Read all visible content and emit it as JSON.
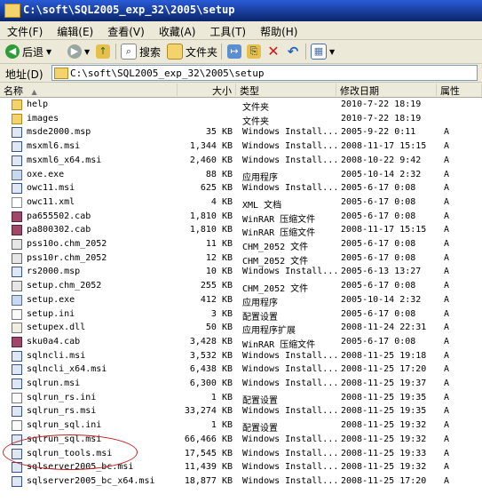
{
  "window": {
    "title": "C:\\soft\\SQL2005_exp_32\\2005\\setup"
  },
  "menu": {
    "items": [
      "文件(F)",
      "编辑(E)",
      "查看(V)",
      "收藏(A)",
      "工具(T)",
      "帮助(H)"
    ]
  },
  "toolbar": {
    "back_label": "后退",
    "search_label": "搜索",
    "folders_label": "文件夹"
  },
  "address": {
    "label": "地址(D)",
    "path": "C:\\soft\\SQL2005_exp_32\\2005\\setup"
  },
  "columns": {
    "name": "名称",
    "size": "大小",
    "type": "类型",
    "modified": "修改日期",
    "attr": "属性"
  },
  "files": [
    {
      "name": "help",
      "size": "",
      "type": "文件夹",
      "date": "2010-7-22 18:19",
      "attr": "",
      "icon": "folder"
    },
    {
      "name": "images",
      "size": "",
      "type": "文件夹",
      "date": "2010-7-22 18:19",
      "attr": "",
      "icon": "folder"
    },
    {
      "name": "msde2000.msp",
      "size": "35 KB",
      "type": "Windows Install...",
      "date": "2005-9-22 0:11",
      "attr": "A",
      "icon": "msi"
    },
    {
      "name": "msxml6.msi",
      "size": "1,344 KB",
      "type": "Windows Install...",
      "date": "2008-11-17 15:15",
      "attr": "A",
      "icon": "msi"
    },
    {
      "name": "msxml6_x64.msi",
      "size": "2,460 KB",
      "type": "Windows Install...",
      "date": "2008-10-22 9:42",
      "attr": "A",
      "icon": "msi"
    },
    {
      "name": "oxe.exe",
      "size": "88 KB",
      "type": "应用程序",
      "date": "2005-10-14 2:32",
      "attr": "A",
      "icon": "exe"
    },
    {
      "name": "owc11.msi",
      "size": "625 KB",
      "type": "Windows Install...",
      "date": "2005-6-17 0:08",
      "attr": "A",
      "icon": "msi"
    },
    {
      "name": "owc11.xml",
      "size": "4 KB",
      "type": "XML 文档",
      "date": "2005-6-17 0:08",
      "attr": "A",
      "icon": "xml"
    },
    {
      "name": "pa655502.cab",
      "size": "1,810 KB",
      "type": "WinRAR 压缩文件",
      "date": "2005-6-17 0:08",
      "attr": "A",
      "icon": "cab"
    },
    {
      "name": "pa800302.cab",
      "size": "1,810 KB",
      "type": "WinRAR 压缩文件",
      "date": "2008-11-17 15:15",
      "attr": "A",
      "icon": "cab"
    },
    {
      "name": "pss10o.chm_2052",
      "size": "11 KB",
      "type": "CHM_2052 文件",
      "date": "2005-6-17 0:08",
      "attr": "A",
      "icon": "chm"
    },
    {
      "name": "pss10r.chm_2052",
      "size": "12 KB",
      "type": "CHM_2052 文件",
      "date": "2005-6-17 0:08",
      "attr": "A",
      "icon": "chm"
    },
    {
      "name": "rs2000.msp",
      "size": "10 KB",
      "type": "Windows Install...",
      "date": "2005-6-13 13:27",
      "attr": "A",
      "icon": "msi"
    },
    {
      "name": "setup.chm_2052",
      "size": "255 KB",
      "type": "CHM_2052 文件",
      "date": "2005-6-17 0:08",
      "attr": "A",
      "icon": "chm"
    },
    {
      "name": "setup.exe",
      "size": "412 KB",
      "type": "应用程序",
      "date": "2005-10-14 2:32",
      "attr": "A",
      "icon": "exe"
    },
    {
      "name": "setup.ini",
      "size": "3 KB",
      "type": "配置设置",
      "date": "2005-6-17 0:08",
      "attr": "A",
      "icon": "ini"
    },
    {
      "name": "setupex.dll",
      "size": "50 KB",
      "type": "应用程序扩展",
      "date": "2008-11-24 22:31",
      "attr": "A",
      "icon": "dll"
    },
    {
      "name": "sku0a4.cab",
      "size": "3,428 KB",
      "type": "WinRAR 压缩文件",
      "date": "2005-6-17 0:08",
      "attr": "A",
      "icon": "cab"
    },
    {
      "name": "sqlncli.msi",
      "size": "3,532 KB",
      "type": "Windows Install...",
      "date": "2008-11-25 19:18",
      "attr": "A",
      "icon": "msi"
    },
    {
      "name": "sqlncli_x64.msi",
      "size": "6,438 KB",
      "type": "Windows Install...",
      "date": "2008-11-25 17:20",
      "attr": "A",
      "icon": "msi"
    },
    {
      "name": "sqlrun.msi",
      "size": "6,300 KB",
      "type": "Windows Install...",
      "date": "2008-11-25 19:37",
      "attr": "A",
      "icon": "msi"
    },
    {
      "name": "sqlrun_rs.ini",
      "size": "1 KB",
      "type": "配置设置",
      "date": "2008-11-25 19:35",
      "attr": "A",
      "icon": "ini"
    },
    {
      "name": "sqlrun_rs.msi",
      "size": "33,274 KB",
      "type": "Windows Install...",
      "date": "2008-11-25 19:35",
      "attr": "A",
      "icon": "msi"
    },
    {
      "name": "sqlrun_sql.ini",
      "size": "1 KB",
      "type": "配置设置",
      "date": "2008-11-25 19:32",
      "attr": "A",
      "icon": "ini"
    },
    {
      "name": "sqlrun_sql.msi",
      "size": "66,466 KB",
      "type": "Windows Install...",
      "date": "2008-11-25 19:32",
      "attr": "A",
      "icon": "msi"
    },
    {
      "name": "sqlrun_tools.msi",
      "size": "17,545 KB",
      "type": "Windows Install...",
      "date": "2008-11-25 19:33",
      "attr": "A",
      "icon": "msi"
    },
    {
      "name": "sqlserver2005_bc.msi",
      "size": "11,439 KB",
      "type": "Windows Install...",
      "date": "2008-11-25 19:32",
      "attr": "A",
      "icon": "msi"
    },
    {
      "name": "sqlserver2005_bc_x64.msi",
      "size": "18,877 KB",
      "type": "Windows Install...",
      "date": "2008-11-25 17:20",
      "attr": "A",
      "icon": "msi"
    }
  ]
}
